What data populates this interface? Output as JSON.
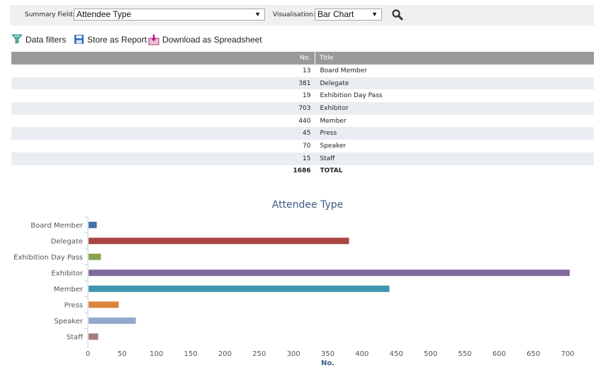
{
  "controls": {
    "summary_field_label": "Summary Field:",
    "summary_field_value": "Attendee Type",
    "visualisation_label": "Visualisation:",
    "visualisation_value": "Bar Chart",
    "dropdown_arrow": "▼",
    "search_icon": "search-icon"
  },
  "toolbar": {
    "data_filters": "Data filters",
    "store_report": "Store as Report",
    "download": "Download as Spreadsheet"
  },
  "table": {
    "headers": {
      "no": "No.",
      "title": "Title"
    },
    "rows": [
      {
        "no": "13",
        "title": "Board Member"
      },
      {
        "no": "381",
        "title": "Delegate"
      },
      {
        "no": "19",
        "title": "Exhibition Day Pass"
      },
      {
        "no": "703",
        "title": "Exhibitor"
      },
      {
        "no": "440",
        "title": "Member"
      },
      {
        "no": "45",
        "title": "Press"
      },
      {
        "no": "70",
        "title": "Speaker"
      },
      {
        "no": "15",
        "title": "Staff"
      }
    ],
    "total": {
      "no": "1686",
      "title": "TOTAL"
    }
  },
  "chart_data": {
    "type": "bar",
    "orientation": "horizontal",
    "title": "Attendee Type",
    "xlabel": "No.",
    "ylabel": "",
    "categories": [
      "Board Member",
      "Delegate",
      "Exhibition Day Pass",
      "Exhibitor",
      "Member",
      "Press",
      "Speaker",
      "Staff"
    ],
    "values": [
      13,
      381,
      19,
      703,
      440,
      45,
      70,
      15
    ],
    "colors": [
      "#4572a7",
      "#aa4643",
      "#89a54e",
      "#80699b",
      "#3d96ae",
      "#db843d",
      "#92a8cd",
      "#a47d7c"
    ],
    "xlim": [
      0,
      700
    ],
    "xticks": [
      0,
      50,
      100,
      150,
      200,
      250,
      300,
      350,
      400,
      450,
      500,
      550,
      600,
      650,
      700
    ],
    "grid": false,
    "legend": "none"
  }
}
